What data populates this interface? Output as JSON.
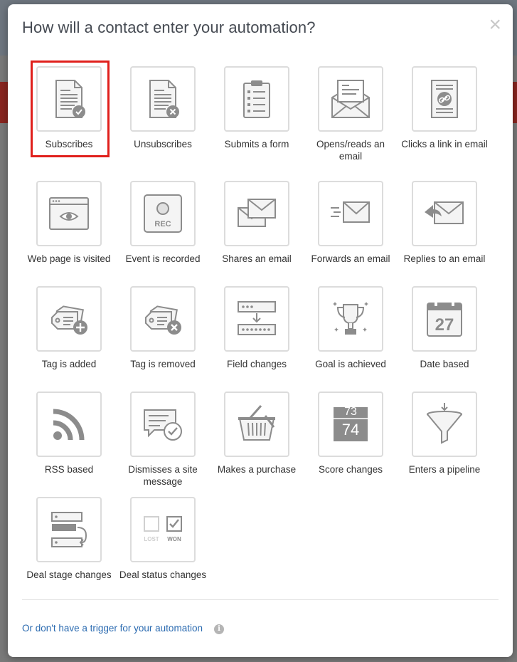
{
  "modal": {
    "title": "How will a contact enter your automation?",
    "close_label": "×"
  },
  "triggers": [
    {
      "label": "Subscribes",
      "icon": "subscribe-document-icon",
      "selected": true
    },
    {
      "label": "Unsubscribes",
      "icon": "unsubscribe-document-icon"
    },
    {
      "label": "Submits a form",
      "icon": "clipboard-form-icon"
    },
    {
      "label": "Opens/reads an email",
      "icon": "open-envelope-icon"
    },
    {
      "label": "Clicks a link in email",
      "icon": "link-document-icon"
    },
    {
      "label": "Web page is visited",
      "icon": "browser-eye-icon"
    },
    {
      "label": "Event is recorded",
      "icon": "record-icon",
      "icon_text": "REC"
    },
    {
      "label": "Shares an email",
      "icon": "share-envelopes-icon"
    },
    {
      "label": "Forwards an email",
      "icon": "forward-envelope-icon"
    },
    {
      "label": "Replies to an email",
      "icon": "reply-envelope-icon"
    },
    {
      "label": "Tag is added",
      "icon": "tag-add-icon"
    },
    {
      "label": "Tag is removed",
      "icon": "tag-remove-icon"
    },
    {
      "label": "Field changes",
      "icon": "field-change-icon"
    },
    {
      "label": "Goal is achieved",
      "icon": "trophy-icon"
    },
    {
      "label": "Date based",
      "icon": "calendar-icon",
      "icon_text": "27"
    },
    {
      "label": "RSS based",
      "icon": "rss-icon"
    },
    {
      "label": "Dismisses a site message",
      "icon": "message-check-icon"
    },
    {
      "label": "Makes a purchase",
      "icon": "basket-icon"
    },
    {
      "label": "Score changes",
      "icon": "score-icon",
      "icon_text_top": "73",
      "icon_text_bottom": "74"
    },
    {
      "label": "Enters a pipeline",
      "icon": "funnel-icon"
    },
    {
      "label": "Deal stage changes",
      "icon": "deal-stage-icon"
    },
    {
      "label": "Deal status changes",
      "icon": "deal-status-icon",
      "icon_text_left": "LOST",
      "icon_text_right": "WON"
    }
  ],
  "footer": {
    "link_text": "Or don't have a trigger for your automation",
    "info_label": "i"
  },
  "colors": {
    "accent_link": "#2a6ab0",
    "selection_border": "#e0201c",
    "icon_gray": "#8c8c8c"
  }
}
